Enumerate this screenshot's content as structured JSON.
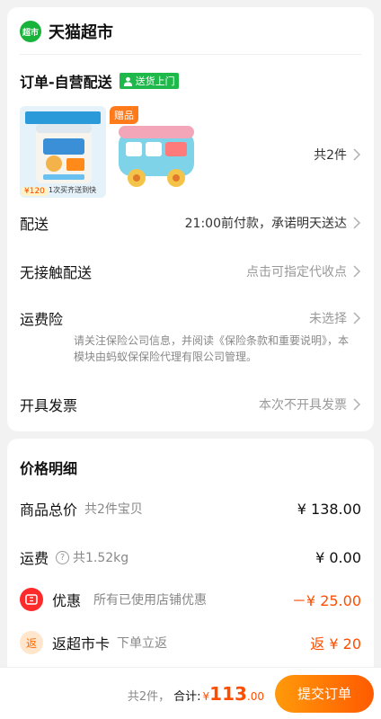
{
  "store": {
    "logo_text": "超市",
    "name": "天猫超市"
  },
  "order": {
    "title": "订单-自营配送",
    "badge": "送货上门",
    "products": [
      {
        "name": "product-milk-powder",
        "price_label": "¥120",
        "promo": "1次买齐送到快"
      },
      {
        "name": "product-toy-bus",
        "gift_tag": "赠品"
      }
    ],
    "count_label": "共2件"
  },
  "rows": {
    "delivery": {
      "label": "配送",
      "value": "21:00前付款，承诺明天送达"
    },
    "contactless": {
      "label": "无接触配送",
      "value": "点击可指定代收点"
    },
    "shipping_insurance": {
      "label": "运费险",
      "value": "未选择",
      "note": "请关注保险公司信息，并阅读《保险条款和重要说明》，本模块由蚂蚁保保险代理有限公司管理。"
    },
    "invoice": {
      "label": "开具发票",
      "value": "本次不开具发票"
    }
  },
  "price_detail": {
    "title": "价格明细",
    "goods_total": {
      "label": "商品总价",
      "sub": "共2件宝贝",
      "amount": "¥ 138.00"
    },
    "shipping": {
      "label": "运费",
      "sub": "共1.52kg",
      "amount": "¥ 0.00"
    },
    "discount": {
      "label": "优惠",
      "sub": "所有已使用店铺优惠",
      "amount": "－¥ 25.00"
    },
    "rebate": {
      "icon_text": "返",
      "label": "返超市卡",
      "sub": "下单立返",
      "amount": "返 ¥ 20"
    }
  },
  "bottom": {
    "count": "共2件，",
    "total_label": "合计:",
    "currency": "¥",
    "total_int": "113",
    "total_dec": ".00",
    "submit": "提交订单"
  },
  "colors": {
    "accent": "#ff4d00",
    "brand_green": "#19b33b",
    "button_start": "#ff9a0a",
    "button_end": "#ff5a00"
  }
}
